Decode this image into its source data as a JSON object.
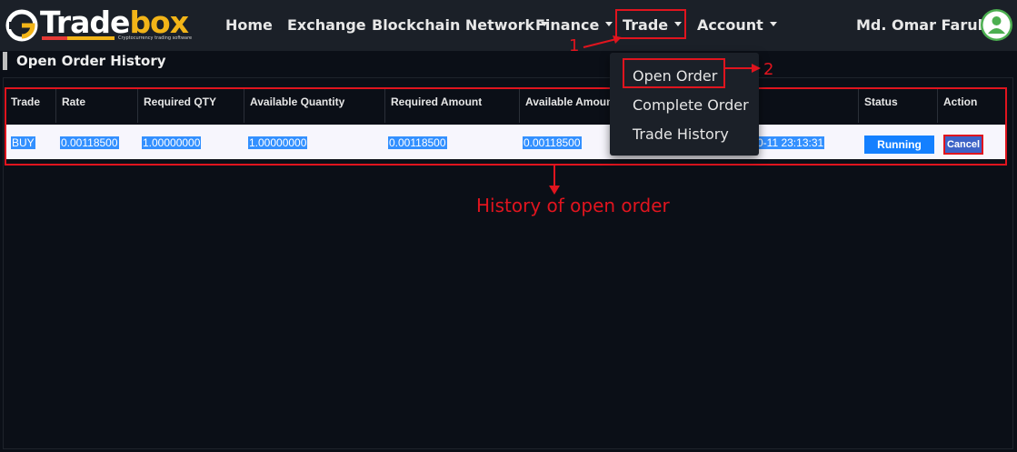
{
  "brand": {
    "name_part1": "Trade",
    "name_part2": "box",
    "tagline": "Cryptocurrency trading software",
    "colors": {
      "accent": "#f2b418",
      "red": "#e53935"
    }
  },
  "nav": {
    "home": "Home",
    "exchange": "Exchange",
    "blockchain": "Blockchain Network",
    "finance": "Finance",
    "trade": "Trade",
    "account": "Account"
  },
  "user": {
    "name": "Md. Omar Faruk",
    "avatar_icon": "user-icon"
  },
  "trade_menu": {
    "items": [
      "Open Order",
      "Complete Order",
      "Trade History"
    ]
  },
  "page": {
    "title": "Open Order History"
  },
  "table": {
    "headers": [
      "Trade",
      "Rate",
      "Required QTY",
      "Available Quantity",
      "Required Amount",
      "Available Amount",
      "Status",
      "Action"
    ],
    "row": {
      "trade": "BUY",
      "rate": "0.00118500",
      "required_qty": "1.00000000",
      "available_qty": "1.00000000",
      "required_amount": "0.00118500",
      "available_amount": "0.00118500",
      "date_partial": "0-11 23:13:31",
      "status": "Running",
      "action": "Cancel"
    }
  },
  "annotations": {
    "step1": "1",
    "step2": "2",
    "caption": "History of open order",
    "color": "#e0141e"
  }
}
